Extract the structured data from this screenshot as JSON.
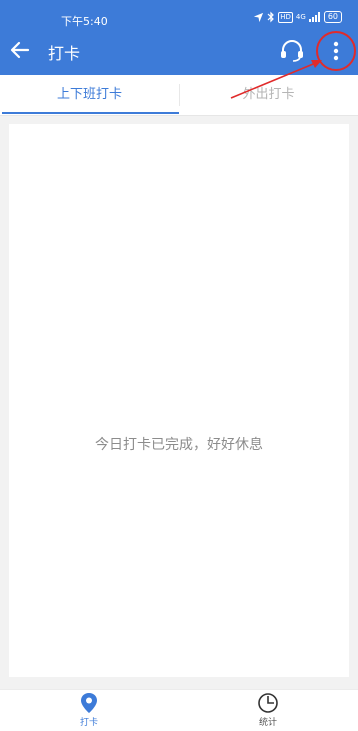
{
  "status_bar": {
    "time": "下午5:40",
    "icons": [
      "location-icon",
      "bluetooth-icon",
      "hd-icon",
      "signal-4g-icon",
      "battery-icon"
    ],
    "hd_label": "HD",
    "network_label": "4G",
    "battery_level": "60"
  },
  "app_bar": {
    "title": "打卡",
    "back_icon": "arrow-left-icon",
    "support_icon": "headset-icon",
    "more_icon": "more-vertical-icon"
  },
  "tabs": [
    {
      "label": "上下班打卡",
      "active": true
    },
    {
      "label": "外出打卡",
      "active": false
    }
  ],
  "content": {
    "message": "今日打卡已完成，好好休息"
  },
  "bottom_nav": [
    {
      "label": "打卡",
      "icon": "location-pin-icon",
      "active": true
    },
    {
      "label": "统计",
      "icon": "clock-icon",
      "active": false
    }
  ],
  "colors": {
    "primary": "#3d7bd8",
    "annotation": "#e02b2b",
    "background": "#f2f2f2"
  }
}
